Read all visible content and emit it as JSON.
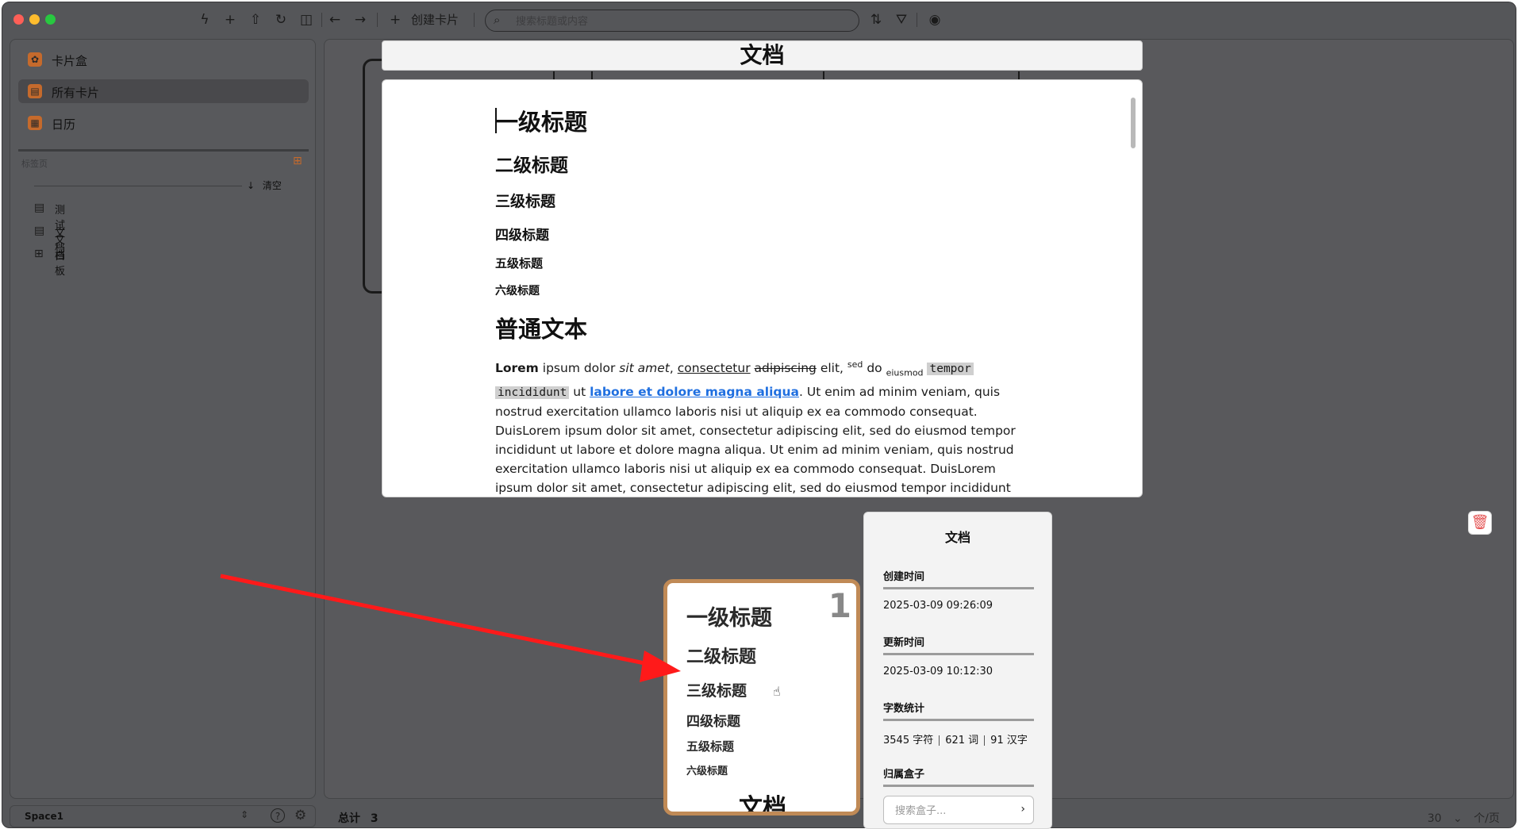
{
  "toolbar": {
    "create_card_label": "创建卡片",
    "search_placeholder": "搜索标题或内容"
  },
  "sidebar": {
    "items": [
      {
        "label": "卡片盒",
        "icon": "card-box-icon"
      },
      {
        "label": "所有卡片",
        "icon": "all-cards-icon",
        "active": true
      },
      {
        "label": "日历",
        "icon": "calendar-icon"
      }
    ],
    "tags_label": "标签页",
    "clear_label": "清空",
    "tree": [
      {
        "label": "测试文档",
        "icon": "document-icon"
      },
      {
        "label": "文档",
        "icon": "document-icon"
      },
      {
        "label": "白板",
        "icon": "whiteboard-icon"
      }
    ],
    "space_name": "Space1"
  },
  "main": {
    "total_label": "总计",
    "total_count": "3",
    "per_page_value": "30",
    "per_page_unit": "个/页"
  },
  "document": {
    "title": "文档",
    "headings": {
      "h1": "一级标题",
      "h2": "二级标题",
      "h3": "三级标题",
      "h4": "四级标题",
      "h5": "五级标题",
      "h6": "六级标题"
    },
    "section_title": "普通文本",
    "paragraph": {
      "bold": "Lorem",
      "t1": " ipsum dolor ",
      "italic": "sit amet",
      "t2": ", ",
      "underline": "consectetur",
      "t3": " ",
      "strike": "adipiscing",
      "t4": " elit, ",
      "sup": "sed",
      "t5": " do ",
      "sub": "eiusmod",
      "t6": " ",
      "code1": "tempor ",
      "code2": "incididunt",
      "t7": " ut ",
      "link": "labore et dolore magna aliqua",
      "rest": ". Ut enim ad minim veniam, quis nostrud exercitation ullamco laboris nisi ut aliquip ex ea commodo consequat. DuisLorem ipsum dolor sit amet, consectetur adipiscing elit, sed do eiusmod tempor incididunt ut labore et dolore magna aliqua. Ut enim ad minim veniam, quis nostrud exercitation ullamco laboris nisi ut aliquip ex ea commodo consequat. DuisLorem ipsum dolor sit amet, consectetur adipiscing elit, sed do eiusmod tempor incididunt ut labore et dolore magna aliqua. Ut enim ad minim veniam, quis nostrud exercitation ullamco laboris nisi ut aliquip ex ea commodo consequat."
    }
  },
  "preview_card": {
    "number": "1",
    "headings": [
      "一级标题",
      "二级标题",
      "三级标题",
      "四级标题",
      "五级标题",
      "六级标题"
    ],
    "doc_name": "文档"
  },
  "info": {
    "title": "文档",
    "created_label": "创建时间",
    "created_value": "2025-03-09 09:26:09",
    "updated_label": "更新时间",
    "updated_value": "2025-03-09 10:12:30",
    "stats_label": "字数统计",
    "chars": "3545 字符",
    "words": "621 词",
    "hanzi": "91 汉字",
    "box_label": "归属盒子",
    "box_search_placeholder": "搜索盒子..."
  },
  "colors": {
    "accent": "#c56a2c",
    "arrow": "#ff1a1a",
    "link": "#1f6fe0",
    "card_border": "#c08a56"
  }
}
